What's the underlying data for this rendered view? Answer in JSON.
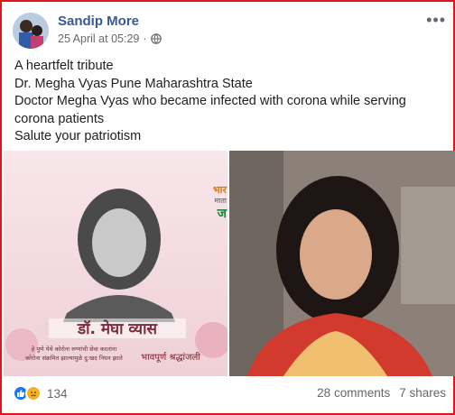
{
  "post": {
    "author": "Sandip More",
    "timestamp": "25 April at 05:29",
    "privacy_icon": "globe-icon",
    "more_icon": "more-options-icon",
    "text_lines": [
      "A heartfelt tribute",
      "Dr. Megha Vyas Pune Maharashtra State",
      "Doctor Megha Vyas who became infected with corona while serving corona patients",
      "Salute your patriotism"
    ],
    "photo1_caption": {
      "name": "डॉ. मेघा व्यास",
      "line1": "हे पुणे येथे कोरोना रुग्णांची सेवा करतांना",
      "line2": "कोरोना संक्रमित झाल्यामुळे दु:खद निधन झाले",
      "tribute": "भावपूर्ण श्रद्धांजली",
      "corner_top": "भार",
      "corner_mid": "माता",
      "corner_bottom": "ज"
    },
    "stats": {
      "reaction_count": "134",
      "comments": "28 comments",
      "shares": "7 shares"
    }
  },
  "colors": {
    "frame": "#e0161a",
    "author": "#385898",
    "like": "#1877f2",
    "sad": "#f7b125"
  }
}
